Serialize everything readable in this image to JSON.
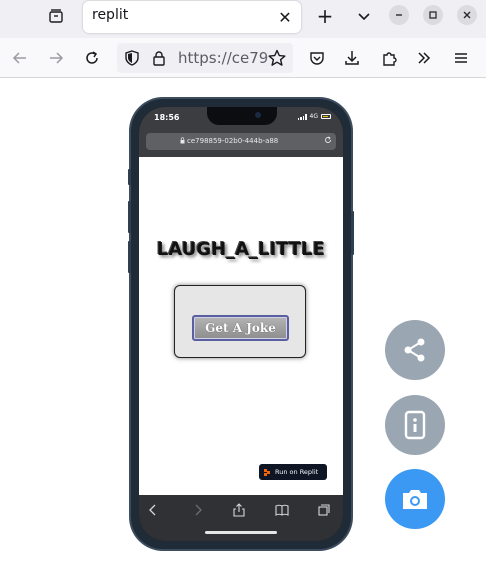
{
  "browser": {
    "tab_title": "replit",
    "url_text": "https://ce79",
    "close_glyph": "✕",
    "new_tab_glyph": "+"
  },
  "phone": {
    "status_time": "18:56",
    "network": "4G",
    "address_text": "ce798859-02b0-444b-a88",
    "app_title": "LAUGH_A_LITTLE",
    "joke_button_label": "Get A Joke",
    "badge_label": "Run on Replit"
  },
  "icons": {
    "tab_list": "tab-list-icon",
    "back": "back-arrow-icon",
    "forward": "forward-arrow-icon",
    "reload": "reload-icon",
    "shield": "shield-icon",
    "lock": "lock-icon",
    "bookmark": "star-icon",
    "pocket": "pocket-icon",
    "download": "download-icon",
    "extensions": "puzzle-icon",
    "overflow": "chevrons-right-icon",
    "menu": "hamburger-menu-icon",
    "share": "share-icon",
    "device": "phone-device-icon",
    "camera": "camera-icon"
  },
  "colors": {
    "fab_gray": "#9aa6b2",
    "fab_blue": "#3b99f3",
    "phone_frame": "#1f2b36",
    "replit_orange": "#f26207"
  }
}
